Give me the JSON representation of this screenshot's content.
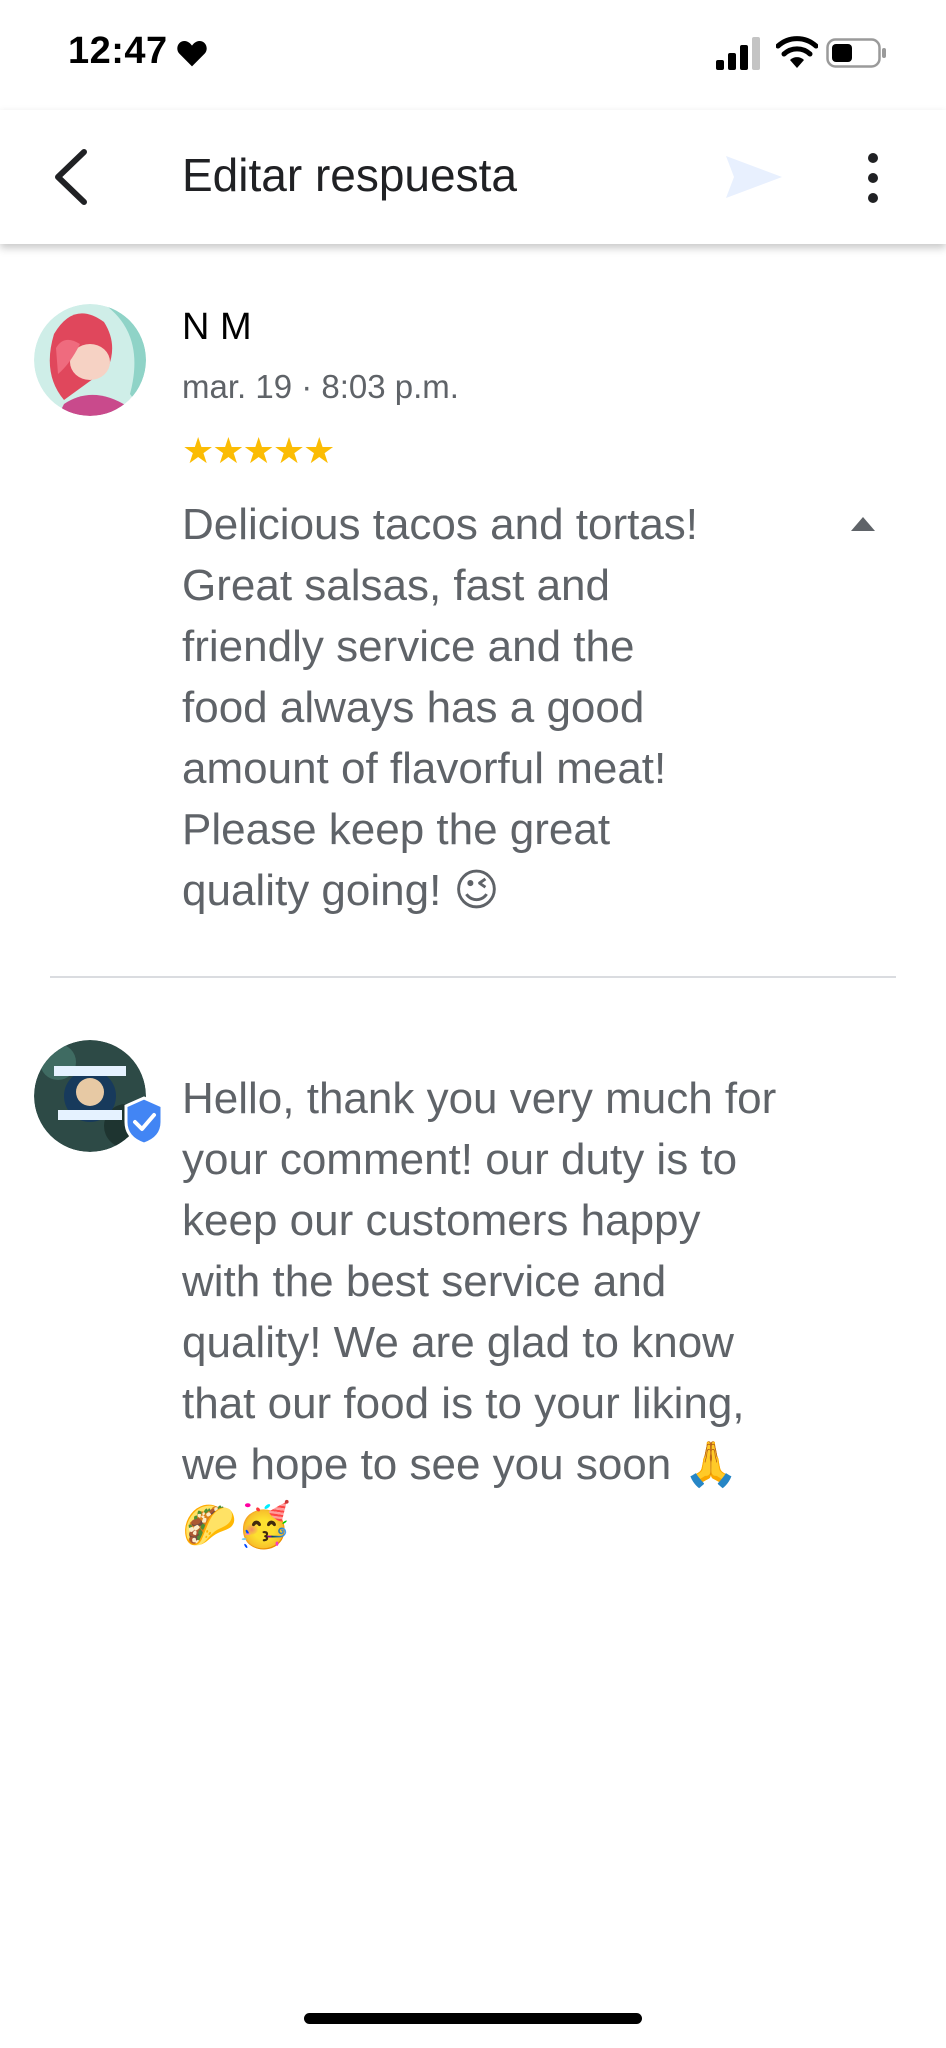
{
  "status_bar": {
    "time": "12:47",
    "icons": [
      "heart-icon",
      "signal-icon",
      "wifi-icon",
      "battery-icon"
    ]
  },
  "app_bar": {
    "title": "Editar respuesta",
    "icons": [
      "back-arrow-icon",
      "send-icon",
      "more-vert-icon"
    ]
  },
  "review": {
    "reviewer_name": "N M",
    "date": "mar. 19 · 8:03 p.m.",
    "stars": "★★★★★",
    "rating": 5,
    "text": "Delicious tacos and tortas!\nGreat salsas, fast and\nfriendly service and the\nfood always has a good\namount of flavorful meat!\nPlease keep the great\nquality going! 😉"
  },
  "reply": {
    "text": "Hello, thank you very much for\nyour comment!  our duty is to\nkeep our customers happy\nwith the best service and\nquality!  We are glad to know\nthat our food is to your liking,\nwe hope to see you soon 🙏\n🌮🥳"
  },
  "colors": {
    "star": "#fbbc04",
    "body_text": "#5f6368",
    "verified_badge": "#4285f4",
    "send_disabled": "#e8f0fe"
  }
}
